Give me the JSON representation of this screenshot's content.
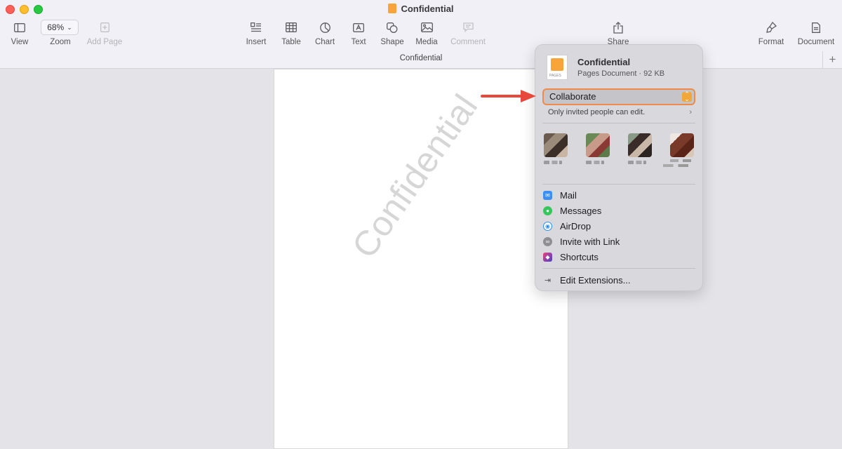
{
  "window": {
    "title": "Confidential",
    "doc_tab": "Confidential"
  },
  "toolbar": {
    "view": "View",
    "zoom_value": "68%",
    "zoom": "Zoom",
    "add_page": "Add Page",
    "insert": "Insert",
    "table": "Table",
    "chart": "Chart",
    "text": "Text",
    "shape": "Shape",
    "media": "Media",
    "comment": "Comment",
    "share": "Share",
    "format": "Format",
    "document": "Document",
    "add_tab": "+"
  },
  "document": {
    "watermark": "Confidential"
  },
  "share_popover": {
    "doc_name": "Confidential",
    "doc_info": "Pages Document · 92 KB",
    "doc_icon_caption": "PAGES",
    "mode": "Collaborate",
    "permission": "Only invited people can edit.",
    "items": [
      {
        "label": "Mail",
        "icon": "mail-icon",
        "color": "#3b8ff3"
      },
      {
        "label": "Messages",
        "icon": "messages-icon",
        "color": "#34c759"
      },
      {
        "label": "AirDrop",
        "icon": "airdrop-icon",
        "color": "#2b8cf0"
      },
      {
        "label": "Invite with Link",
        "icon": "link-icon",
        "color": "#8e8e93"
      },
      {
        "label": "Shortcuts",
        "icon": "shortcuts-icon",
        "color": "#4a3fd1"
      }
    ],
    "edit_extensions": "Edit Extensions..."
  },
  "colors": {
    "accent_orange": "#f2a73b",
    "highlight_border": "#f08a4b",
    "annotation_arrow": "#e8483c"
  }
}
